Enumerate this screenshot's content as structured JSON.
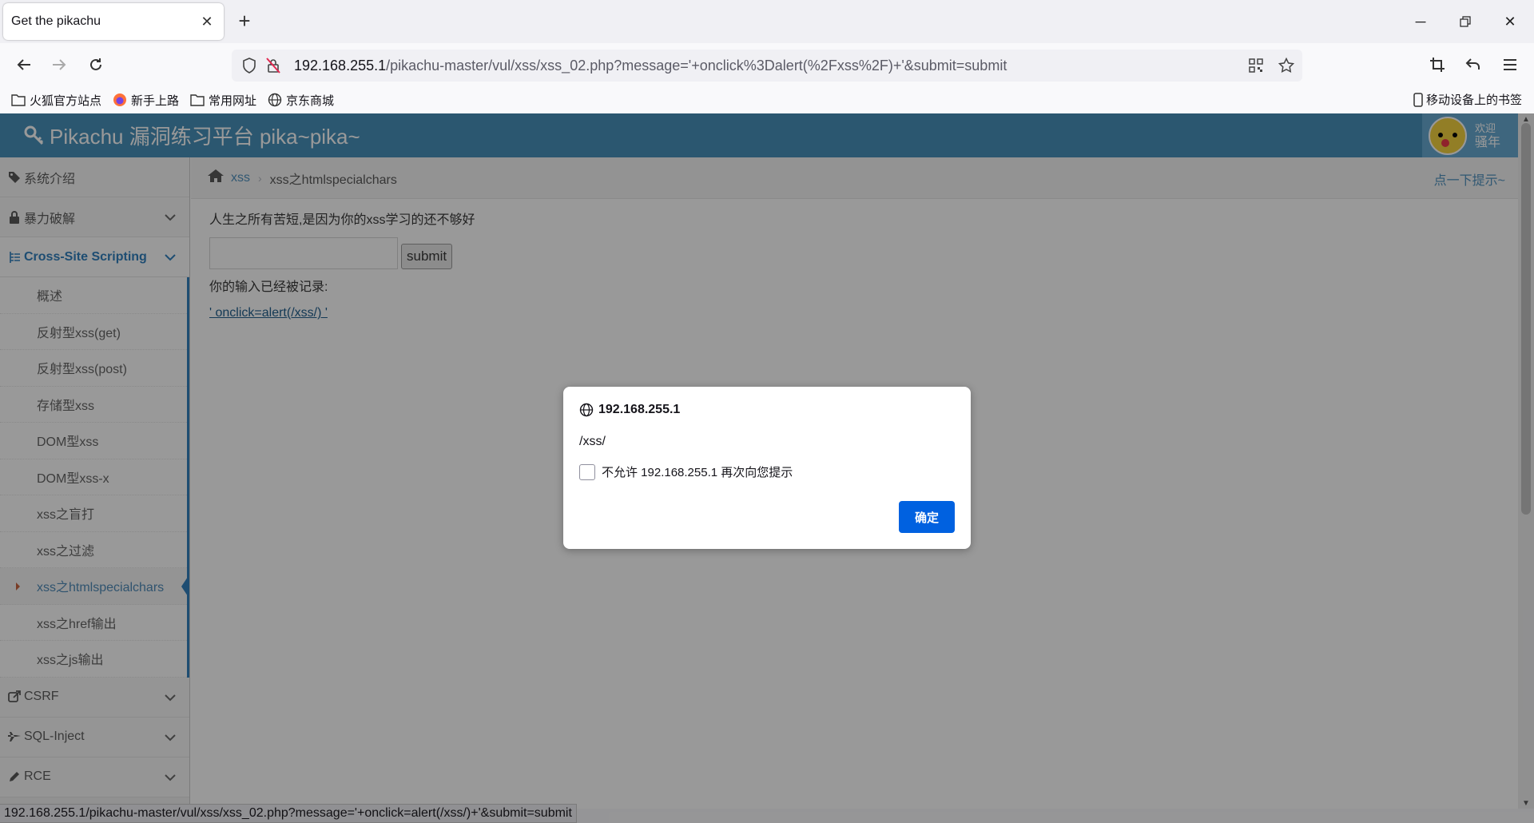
{
  "browser": {
    "tab_title": "Get the pikachu",
    "url_host": "192.168.255.1",
    "url_path": "/pikachu-master/vul/xss/xss_02.php?message='+onclick%3Dalert(%2Fxss%2F)+'&submit=submit",
    "bookmarks": [
      "火狐官方站点",
      "新手上路",
      "常用网址",
      "京东商城"
    ],
    "mobile_bookmarks": "移动设备上的书签",
    "status_url": "192.168.255.1/pikachu-master/vul/xss/xss_02.php?message='+onclick=alert(/xss/)+'&submit=submit"
  },
  "site": {
    "title": "Pikachu 漏洞练习平台 pika~pika~",
    "user_welcome": "欢迎",
    "user_name": "骚年"
  },
  "sidebar": {
    "items": [
      {
        "label": "系统介绍"
      },
      {
        "label": "暴力破解"
      },
      {
        "label": "Cross-Site Scripting"
      },
      {
        "label": "CSRF"
      },
      {
        "label": "SQL-Inject"
      },
      {
        "label": "RCE"
      }
    ],
    "xss_sub": [
      "概述",
      "反射型xss(get)",
      "反射型xss(post)",
      "存储型xss",
      "DOM型xss",
      "DOM型xss-x",
      "xss之盲打",
      "xss之过滤",
      "xss之htmlspecialchars",
      "xss之href输出",
      "xss之js输出"
    ]
  },
  "main": {
    "breadcrumb_home": "xss",
    "breadcrumb_current": "xss之htmlspecialchars",
    "hint": "点一下提示~",
    "intro": "人生之所有苦短,是因为你的xss学习的还不够好",
    "submit_label": "submit",
    "input_value": "",
    "logged_label": "你的输入已经被记录:",
    "output_link": "' onclick=alert(/xss/) '"
  },
  "dialog": {
    "origin": "192.168.255.1",
    "message": "/xss/",
    "checkbox_label": "不允许 192.168.255.1 再次向您提示",
    "ok_label": "确定"
  }
}
